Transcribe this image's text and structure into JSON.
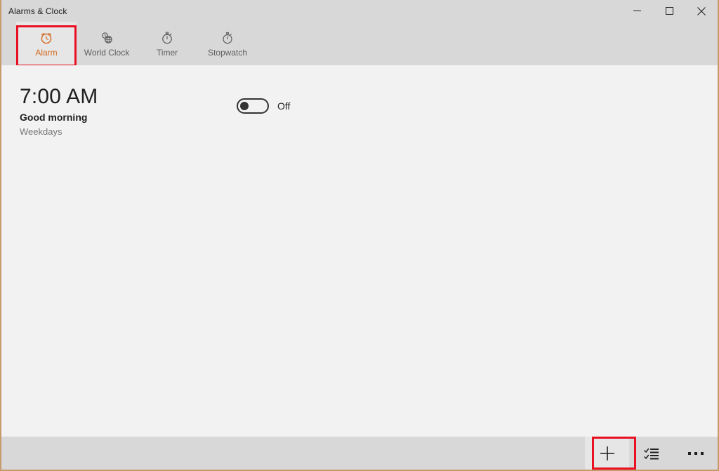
{
  "window": {
    "title": "Alarms & Clock",
    "accent_border_color": "#c89a6a",
    "titlebar_color": "#d8d8d8",
    "content_color": "#f2f2f2",
    "selected_tab_color": "#d2691e",
    "highlight_color": "#e81123"
  },
  "caption": {
    "minimize": "minimize-icon",
    "maximize": "maximize-icon",
    "close": "close-icon"
  },
  "tabs": [
    {
      "id": "alarm",
      "label": "Alarm",
      "icon": "alarm-clock-icon",
      "selected": true
    },
    {
      "id": "world-clock",
      "label": "World Clock",
      "icon": "globe-clock-icon",
      "selected": false
    },
    {
      "id": "timer",
      "label": "Timer",
      "icon": "timer-icon",
      "selected": false
    },
    {
      "id": "stopwatch",
      "label": "Stopwatch",
      "icon": "stopwatch-icon",
      "selected": false
    }
  ],
  "alarms": [
    {
      "time": "7:00 AM",
      "name": "Good morning",
      "repeat": "Weekdays",
      "enabled": false,
      "toggle_state_label": "Off"
    }
  ],
  "commandbar": {
    "add_label": "+",
    "add_name": "add-alarm-button",
    "edit_name": "edit-alarms-button",
    "more_name": "more-options-button"
  }
}
